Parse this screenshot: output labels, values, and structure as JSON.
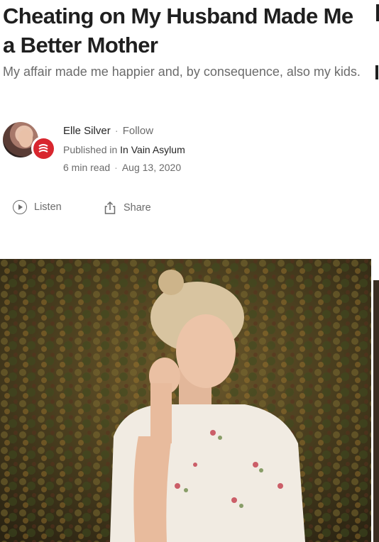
{
  "article": {
    "title": "Cheating on My Husband Made Me a Better Mother",
    "subtitle": "My affair made me happier and, by consequence, also my kids."
  },
  "author": {
    "name": "Elle Silver",
    "separator": "·",
    "follow_label": "Follow",
    "published_in_label": "Published in",
    "publication": "In Vain Asylum",
    "read_time": "6 min read",
    "date": "Aug 13, 2020"
  },
  "actions": {
    "listen_label": "Listen",
    "share_label": "Share",
    "listen_icon": "play-circle-icon",
    "share_icon": "share-icon"
  },
  "colors": {
    "title": "#1f1f1f",
    "muted": "#6b6b6b",
    "publication_badge": "#d8262e"
  }
}
